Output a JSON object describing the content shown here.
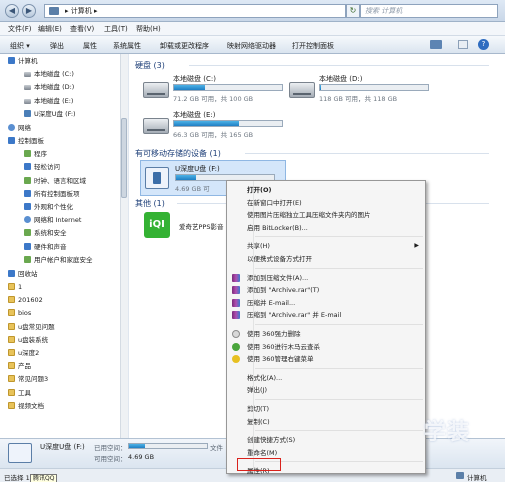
{
  "address_bar": {
    "back": "◀",
    "forward": "▶",
    "path": "▸ 计算机 ▸",
    "refresh": "↻",
    "search_placeholder": "搜索 计算机"
  },
  "menu": [
    "文件(F)",
    "编辑(E)",
    "查看(V)",
    "工具(T)",
    "帮助(H)"
  ],
  "toolbar": [
    "组织 ▾",
    "弹出",
    "属性",
    "系统属性",
    "卸载或更改程序",
    "映射网络驱动器",
    "打开控制面板"
  ],
  "nav": [
    "计算机",
    "本地磁盘 (C:)",
    "本地磁盘 (D:)",
    "本地磁盘 (E:)",
    "U深度U盘 (F:)",
    "网络",
    "控制面板",
    "程序",
    "轻松访问",
    "时钟、语言和区域",
    "所有控制面板项",
    "外观和个性化",
    "网络和 Internet",
    "系统和安全",
    "硬件和声音",
    "用户帐户和家庭安全",
    "回收站",
    "1",
    "201602",
    "bios",
    "u盘常见问题",
    "u盘装系统",
    "u深度2",
    "产品",
    "常见问题3",
    "工具",
    "视频文档"
  ],
  "content": {
    "hdd_group": "硬盘 (3)",
    "removable_group": "有可移动存储的设备 (1)",
    "other_group": "其他 (1)",
    "drives": [
      {
        "name": "本地磁盘 (C:)",
        "free": "71.2 GB 可用，共 100 GB",
        "used_pct": 29
      },
      {
        "name": "本地磁盘 (D:)",
        "free": "118 GB 可用，共 118 GB",
        "used_pct": 1
      },
      {
        "name": "本地磁盘 (E:)",
        "free": "66.3 GB 可用，共 165 GB",
        "used_pct": 60
      }
    ],
    "usb": {
      "name": "U深度U盘 (F:)",
      "free": "4.69 GB 可",
      "used_pct": 20
    },
    "other_item": "爱奇艺PPS影音",
    "iqiyi_logo": "iQI"
  },
  "context_menu": [
    "打开(O)",
    "在新窗口中打开(E)",
    "使用图片压缩独立工具压缩文件夹内的图片",
    "启用 BitLocker(B)...",
    "共享(H)",
    "以便携式设备方式打开",
    "添加到压缩文件(A)...",
    "添加到 \"Archive.rar\"(T)",
    "压缩并 E-mail...",
    "压缩到 \"Archive.rar\" 并 E-mail",
    "使用 360强力删除",
    "使用 360进行木马云查杀",
    "使用 360管理右键菜单",
    "格式化(A)...",
    "弹出(J)",
    "剪切(T)",
    "复制(C)",
    "创建快捷方式(S)",
    "重命名(M)",
    "属性(R)"
  ],
  "details": {
    "name": "U深度U盘 (F:)",
    "used_label": "已用空间：",
    "free_label": "可用空间：",
    "free_value": "4.69 GB",
    "fs_label": "文件"
  },
  "status": {
    "left": "已选择 1",
    "tooltip": "腾讯QQ",
    "computer": "计算机"
  },
  "watermark": "学装"
}
